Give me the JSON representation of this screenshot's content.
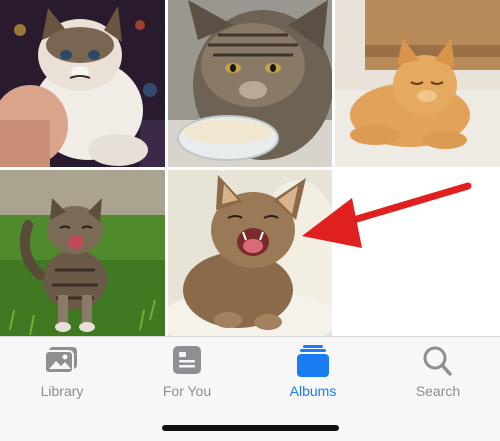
{
  "photos": [
    {
      "name": "grumpy-cat-held-photo"
    },
    {
      "name": "tabby-cat-bowl-photo"
    },
    {
      "name": "orange-cat-bed-photo"
    },
    {
      "name": "meowing-kitten-grass-photo"
    },
    {
      "name": "yawning-cat-cushion-photo"
    }
  ],
  "tabbar": {
    "tabs": [
      {
        "label": "Library",
        "icon": "library-icon",
        "active": false
      },
      {
        "label": "For You",
        "icon": "for-you-icon",
        "active": false
      },
      {
        "label": "Albums",
        "icon": "albums-icon",
        "active": true
      },
      {
        "label": "Search",
        "icon": "search-icon",
        "active": false
      }
    ]
  },
  "colors": {
    "accent": "#1a7cf2",
    "inactive": "#8e8e93",
    "arrow": "#e0201f",
    "tabbar_bg": "#f7f7f7"
  }
}
